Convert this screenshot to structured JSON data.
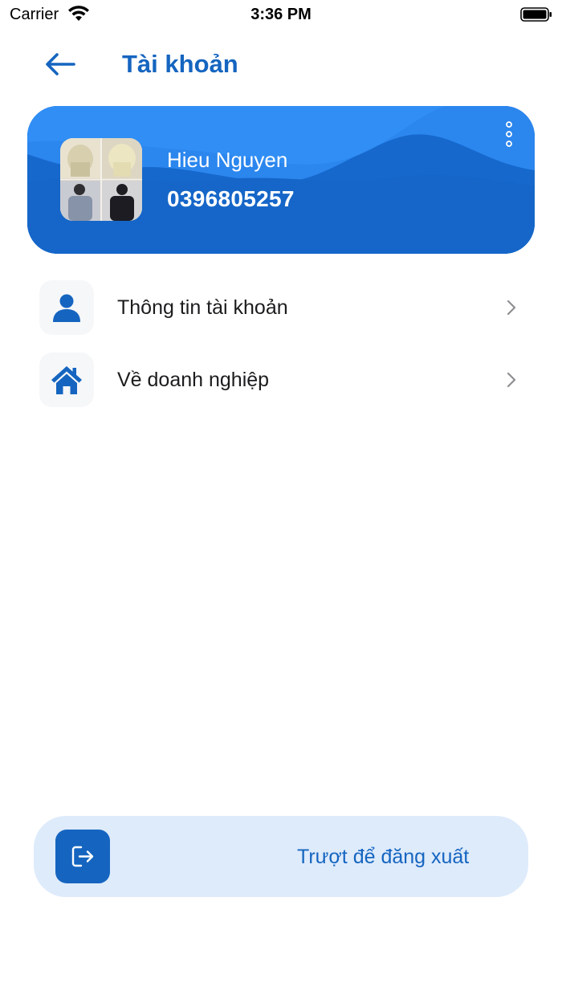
{
  "status_bar": {
    "carrier": "Carrier",
    "time": "3:36 PM"
  },
  "header": {
    "title": "Tài khoản",
    "back_icon": "arrow-left-icon"
  },
  "profile": {
    "name": "Hieu Nguyen",
    "phone": "0396805257",
    "more_icon": "more-vertical-icon"
  },
  "menu": [
    {
      "label": "Thông tin tài khoản",
      "icon": "user-icon"
    },
    {
      "label": "Về doanh nghiệp",
      "icon": "home-icon"
    }
  ],
  "logout": {
    "label": "Trượt để đăng xuất",
    "icon": "logout-icon"
  },
  "colors": {
    "primary": "#1565c0",
    "card": "#1769d0",
    "card_wave": "#2e8df0",
    "slider_bg": "#deebfb",
    "icon_bg": "#f6f7f9"
  }
}
